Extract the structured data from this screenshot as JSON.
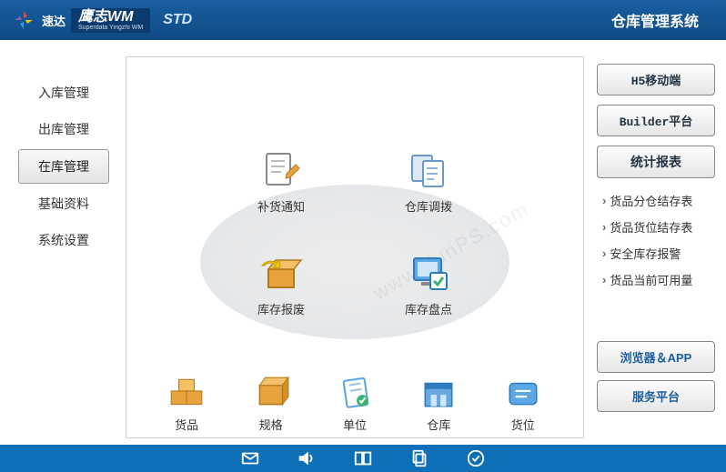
{
  "header": {
    "brand1": "速达",
    "brand2_main": "鹰志WM",
    "brand2_sub": "Superdata Yingzhi WM",
    "std": "STD",
    "title": "仓库管理系统"
  },
  "sidebar": {
    "items": [
      {
        "label": "入库管理",
        "active": false
      },
      {
        "label": "出库管理",
        "active": false
      },
      {
        "label": "在库管理",
        "active": true
      },
      {
        "label": "基础资料",
        "active": false
      },
      {
        "label": "系统设置",
        "active": false
      }
    ]
  },
  "center_items": [
    {
      "label": "补货通知",
      "icon": "note-edit-icon"
    },
    {
      "label": "仓库调拨",
      "icon": "transfer-doc-icon"
    },
    {
      "label": "库存报废",
      "icon": "box-recycle-icon"
    },
    {
      "label": "库存盘点",
      "icon": "inventory-check-icon"
    }
  ],
  "bottom_items": [
    {
      "label": "货品",
      "icon": "goods-boxes-icon"
    },
    {
      "label": "规格",
      "icon": "spec-box-icon"
    },
    {
      "label": "单位",
      "icon": "unit-sheet-icon"
    },
    {
      "label": "仓库",
      "icon": "warehouse-icon"
    },
    {
      "label": "货位",
      "icon": "location-icon"
    }
  ],
  "right_panel": {
    "buttons": [
      "H5移动端",
      "Builder平台",
      "统计报表"
    ],
    "links": [
      "货品分仓结存表",
      "货品货位结存表",
      "安全库存报警",
      "货品当前可用量"
    ],
    "bottom_buttons": [
      "浏览器＆APP",
      "服务平台"
    ]
  },
  "footer_icons": [
    "mail-icon",
    "sound-icon",
    "book-icon",
    "copy-icon",
    "check-icon"
  ],
  "watermark": "www.YunPS.com"
}
